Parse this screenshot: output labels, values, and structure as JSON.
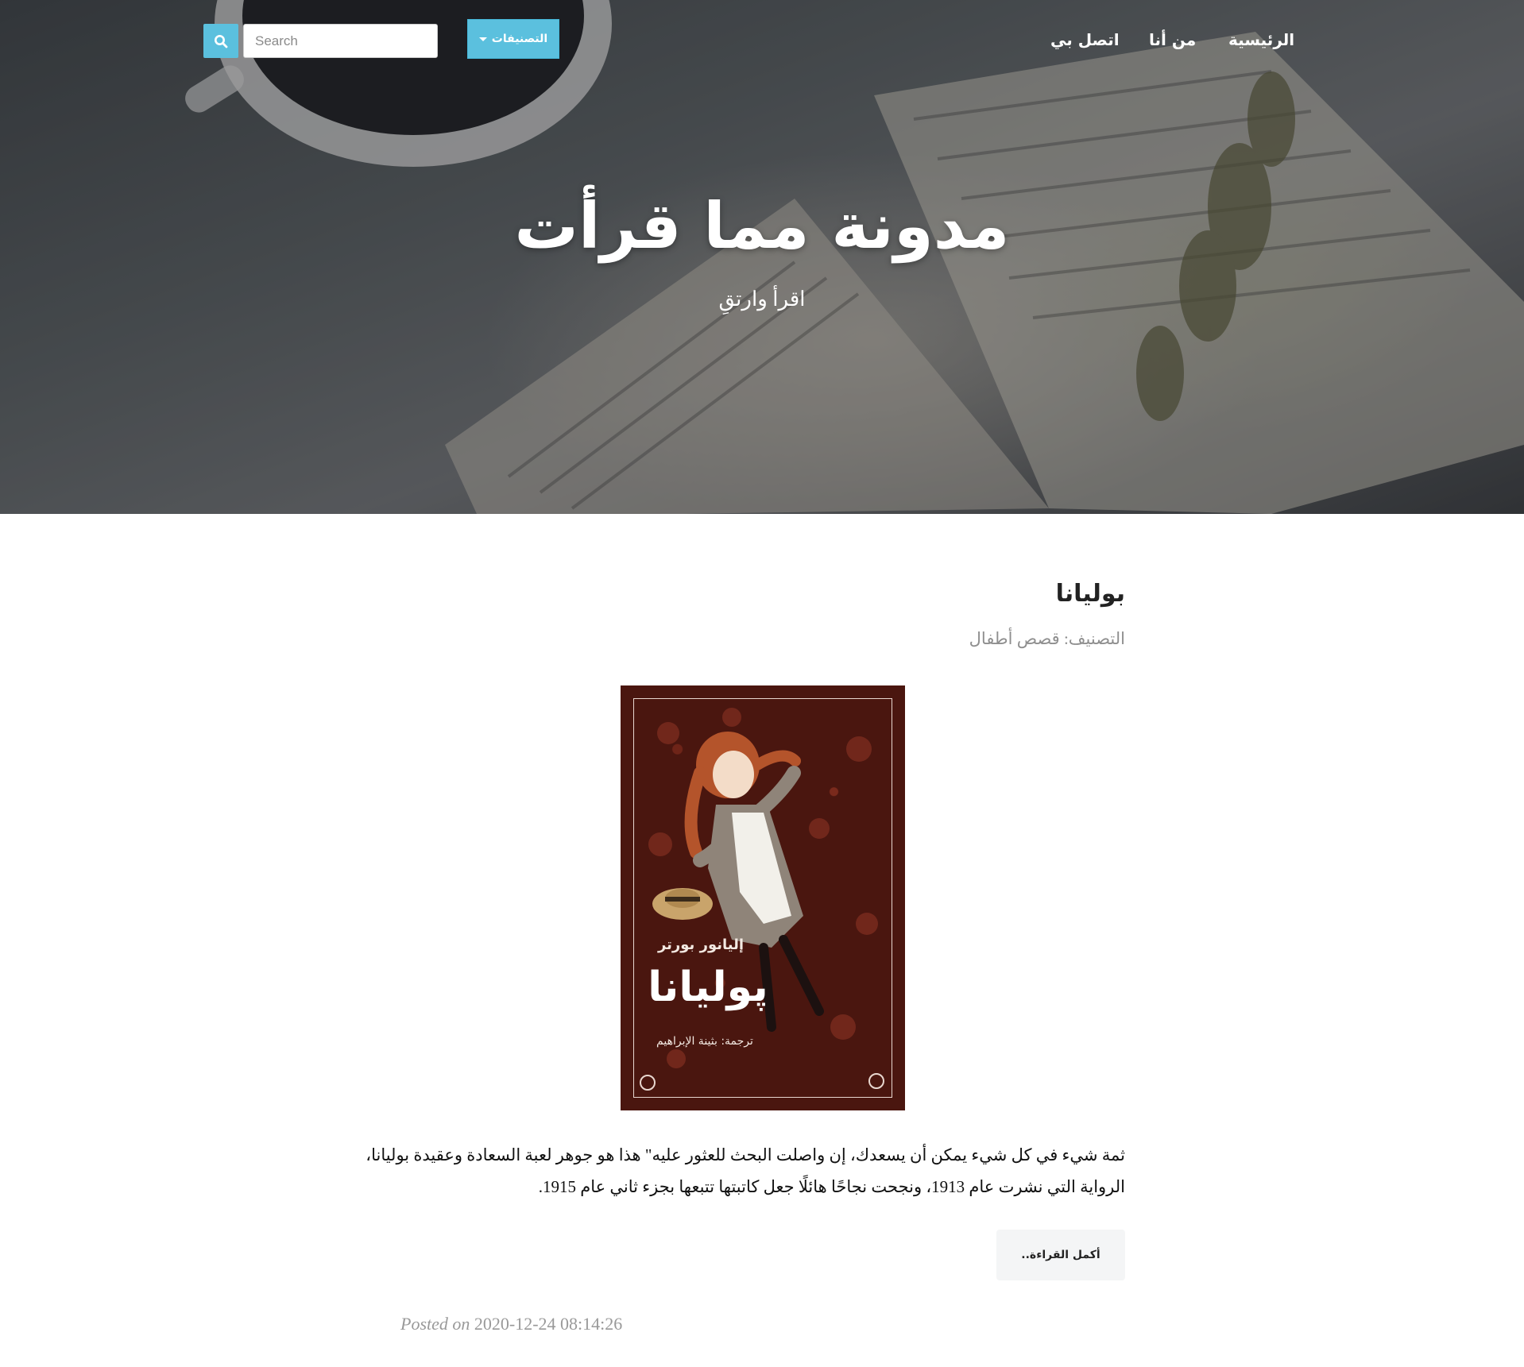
{
  "nav": {
    "home": "الرئيسية",
    "about": "من أنا",
    "contact": "اتصل بي",
    "categories_button": "التصنيفات",
    "search_placeholder": "Search"
  },
  "hero": {
    "title": "مدونة مما قرأت",
    "subtitle": "اقرأ وارتقِ"
  },
  "post": {
    "title": "بوليانا",
    "category_label": "التصنيف:",
    "category_value": "قصص أطفال",
    "cover": {
      "author": "إليانور بورتر",
      "title": "پوليانا",
      "translator": "ترجمة: بثينة الإبراهيم"
    },
    "excerpt_line1": "ثمة شيء في كل شيء يمكن أن يسعدك، إن واصلت البحث للعثور عليه\" هذا هو جوهر لعبة السعادة وعقيدة بوليانا،",
    "excerpt_line2": "الرواية التي نشرت عام 1913، ونجحت نجاحًا هائلًا جعل كاتبتها تتبعها بجزء ثاني عام 1915.",
    "read_more": "أكمل القراءة..",
    "posted_label": "Posted on",
    "posted_date": "2020-12-24 08:14:26"
  },
  "colors": {
    "accent": "#5bc0de",
    "muted": "#999999",
    "text": "#222222"
  },
  "icons": {
    "search": "search-icon",
    "caret": "caret-down-icon"
  }
}
